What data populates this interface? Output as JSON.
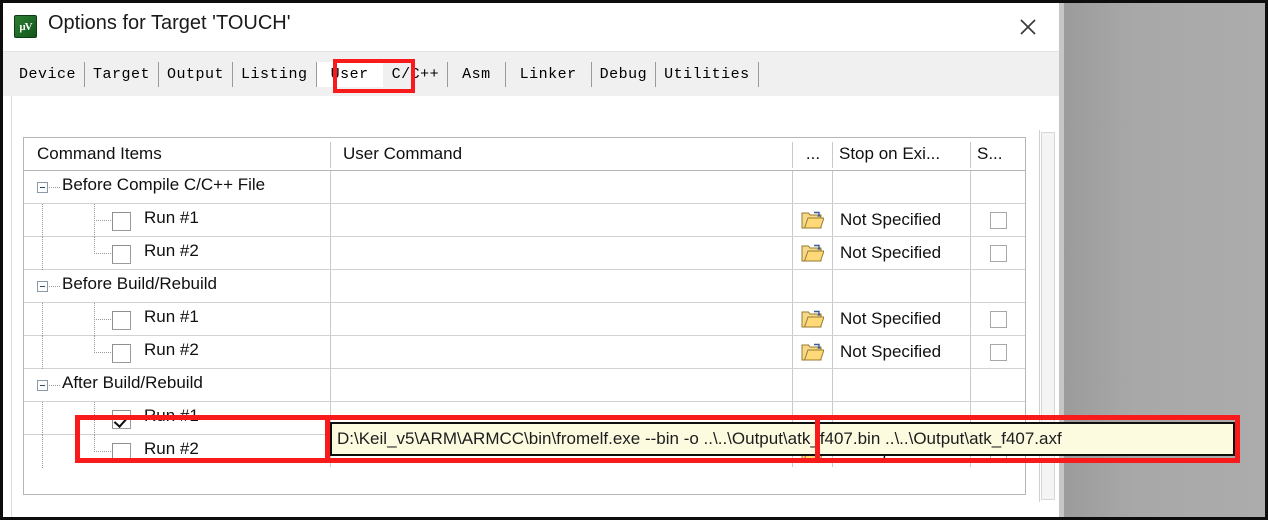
{
  "window": {
    "title": "Options for Target 'TOUCH'",
    "app_icon": "keil-uvision-icon",
    "icon_glyph": "µV",
    "close_label": "✕"
  },
  "tabs": [
    {
      "label": "Device",
      "selected": false
    },
    {
      "label": "Target",
      "selected": false
    },
    {
      "label": "Output",
      "selected": false
    },
    {
      "label": "Listing",
      "selected": false
    },
    {
      "label": "User",
      "selected": true
    },
    {
      "label": "C/C++",
      "selected": false
    },
    {
      "label": "Asm",
      "selected": false
    },
    {
      "label": "Linker",
      "selected": false
    },
    {
      "label": "Debug",
      "selected": false
    },
    {
      "label": "Utilities",
      "selected": false
    }
  ],
  "grid": {
    "headers": {
      "command_items": "Command Items",
      "user_command": "User Command",
      "browse": "...",
      "stop_on_exit": "Stop on Exi...",
      "s_column": "S..."
    },
    "rows": [
      {
        "type": "group",
        "label": "Before Compile C/C++ File",
        "expanded": true,
        "command": "",
        "stop_on_exit": "",
        "has_browse": false,
        "has_s_checkbox": false
      },
      {
        "type": "child",
        "label": "Run #1",
        "checked": false,
        "command": "",
        "stop_on_exit": "Not Specified",
        "has_browse": true,
        "has_s_checkbox": true
      },
      {
        "type": "child",
        "label": "Run #2",
        "checked": false,
        "command": "",
        "stop_on_exit": "Not Specified",
        "has_browse": true,
        "has_s_checkbox": true,
        "last_of_group": true
      },
      {
        "type": "group",
        "label": "Before Build/Rebuild",
        "expanded": true,
        "command": "",
        "stop_on_exit": "",
        "has_browse": false,
        "has_s_checkbox": false
      },
      {
        "type": "child",
        "label": "Run #1",
        "checked": false,
        "command": "",
        "stop_on_exit": "Not Specified",
        "has_browse": true,
        "has_s_checkbox": true
      },
      {
        "type": "child",
        "label": "Run #2",
        "checked": false,
        "command": "",
        "stop_on_exit": "Not Specified",
        "has_browse": true,
        "has_s_checkbox": true,
        "last_of_group": true
      },
      {
        "type": "group",
        "label": "After Build/Rebuild",
        "expanded": true,
        "command": "",
        "stop_on_exit": "",
        "has_browse": false,
        "has_s_checkbox": false
      },
      {
        "type": "child",
        "label": "Run #1",
        "checked": true,
        "command": "D:\\Keil_v5\\ARM\\ARMCC\\bin\\fromelf.exe --bin -o ..\\..\\Output\\atk_f407.bin ..\\..\\Output\\atk_f407.axf",
        "stop_on_exit": "",
        "has_browse": false,
        "has_s_checkbox": false,
        "editing": true,
        "highlighted": true
      },
      {
        "type": "child",
        "label": "Run #2",
        "checked": false,
        "command": "",
        "stop_on_exit": "Not Specified",
        "has_browse": true,
        "has_s_checkbox": true,
        "last_of_group": true
      }
    ]
  },
  "editor": {
    "value": "D:\\Keil_v5\\ARM\\ARMCC\\bin\\fromelf.exe --bin -o ..\\..\\Output\\atk_f407.bin ..\\..\\Output\\atk_f407.axf"
  },
  "annotations": {
    "tab_highlight_color": "#f91b1b",
    "row_highlight_color": "#f91b1b",
    "editor_background": "#fcfbe0"
  },
  "icons": {
    "folder": "folder-open-icon",
    "expander": "tree-collapse-icon",
    "close": "close-icon"
  }
}
